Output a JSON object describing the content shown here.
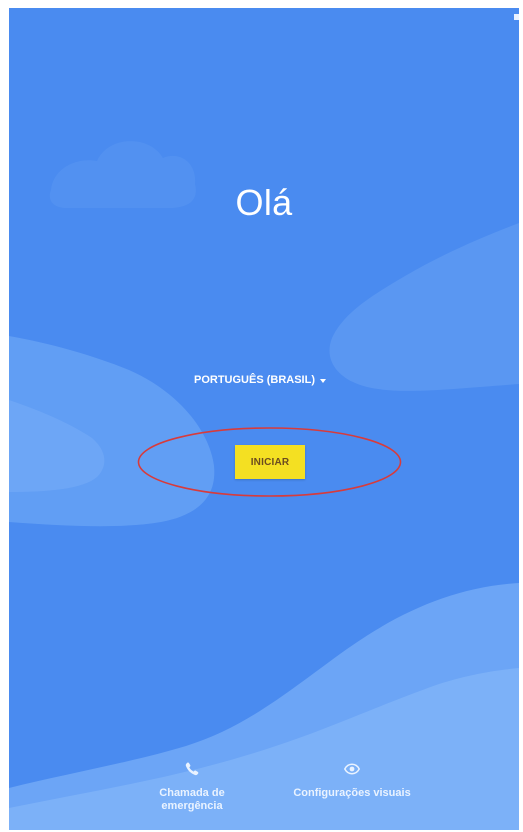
{
  "screen": {
    "title": "Olá",
    "language": {
      "label": "PORTUGUÊS (BRASIL)",
      "icon": "chevron-down-icon"
    },
    "start_button": {
      "label": "INICIAR"
    },
    "bottom_actions": {
      "emergency": {
        "label": "Chamada de emergência",
        "icon": "phone-icon"
      },
      "visual": {
        "label": "Configurações visuais",
        "icon": "eye-icon"
      }
    }
  },
  "colors": {
    "background": "#4a8bf0",
    "button": "#f4e022",
    "annotation": "#d83b3b"
  }
}
